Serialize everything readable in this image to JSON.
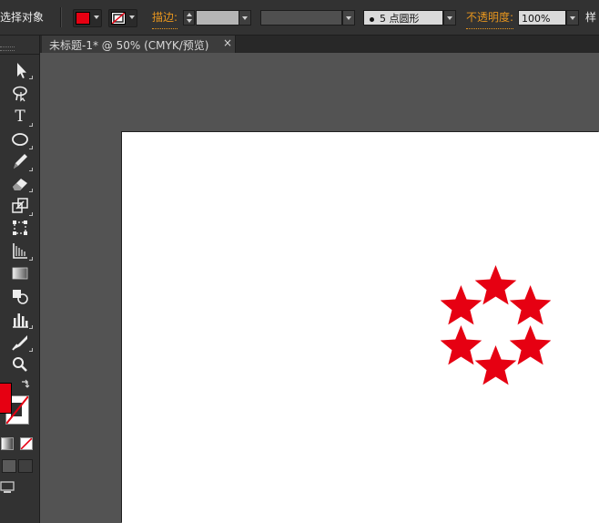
{
  "control_bar": {
    "selection_label": "选择对象",
    "stroke_label": "描边:",
    "stroke_weight": "",
    "brush_value": "5 点圆形",
    "opacity_label": "不透明度:",
    "opacity_value": "100%",
    "style_label": "样",
    "fill_color": "#e60012"
  },
  "document_tab": {
    "title": "未标题-1* @ 50% (CMYK/预览)",
    "close": "×"
  },
  "tools": {
    "type_tool_glyph": "T",
    "fill_color": "#e60012"
  },
  "artwork": {
    "shape": "ring of six red stars",
    "star_count": 6,
    "color": "#e60012"
  }
}
